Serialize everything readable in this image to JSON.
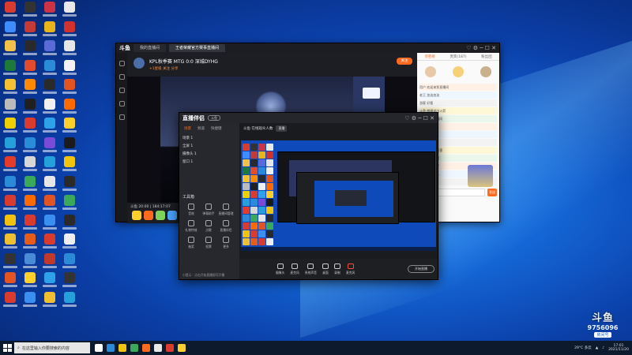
{
  "desktop": {
    "icon_colors": [
      "#d93b2f",
      "#333",
      "#cc3344",
      "#e8e8e8",
      "#3f8cff",
      "#c43a36",
      "#e9b31a",
      "#d2322d",
      "#f5c04a",
      "#2a2a2a",
      "#5a6bd8",
      "#e6e6e6",
      "#1d7a3a",
      "#e14c2c",
      "#2b8bd8",
      "#f2f2f2",
      "#f2c232",
      "#ff8a00",
      "#2a2a2a",
      "#e25522",
      "#bbbbbb",
      "#202020",
      "#f0f0f0",
      "#ff6a00",
      "#f0d000",
      "#d93b2f",
      "#2fa1e8",
      "#ffcf2e",
      "#26a0da",
      "#2a8bd8",
      "#7a4ad8",
      "#1b1b1b",
      "#e53c2a",
      "#d7d7d7",
      "#26a0da",
      "#f1c40f",
      "#2b8bd8",
      "#3aaa5a",
      "#e6e6e6",
      "#2a2a2a",
      "#d93b2f",
      "#ff6a00",
      "#e25522",
      "#3aaa5a",
      "#f4c20d",
      "#d93b2f",
      "#3a8ff0",
      "#2a2a2a",
      "#f0c030",
      "#e85c1a",
      "#d93b2f",
      "#eeeeee",
      "#333333",
      "#4a8bd8",
      "#c0392b",
      "#2b8bd8",
      "#e25522",
      "#ffcf2e",
      "#2fa1e8",
      "#333",
      "#d93b2f",
      "#3a8ff0",
      "#f0c030",
      "#26a0da"
    ]
  },
  "big_window": {
    "logo": "斗鱼",
    "tabs": [
      "我的直播间",
      "王者荣耀官方赛事直播间"
    ],
    "room_title": "KPL秋季赛 MTG 0:0 深城DYHG",
    "subtitle": "+1星级 关注 分享",
    "follow": "关注",
    "controls": "♡ ⚙ ─ ☐ ✕",
    "stream_info": "斗鱼 20:00 | 184:17:07",
    "chat_tabs": [
      "亲密榜",
      "贵宾(187)",
      "粉丝团"
    ],
    "chat_lines": [
      "用户 欢迎来到直播间",
      "老王 加油加油",
      "游客 好看",
      "斗鱼 感谢送出火箭",
      "某人 进入直播间",
      "弹幕 哈哈哈",
      "粉丝 打卡",
      "小鱼 666",
      "路人 主播真厉害",
      "观众 进来看看",
      "用户 来了来了",
      "游客 欢迎新人",
      "粉丝 冲冲冲"
    ],
    "chat_send": "发送",
    "gift_colors": [
      "#ffcf2e",
      "#ff6a1f",
      "#7fd35b",
      "#4aa3ff",
      "#c06cf0"
    ]
  },
  "mid_window": {
    "logo": "直播伴侣",
    "badge": "斗鱼",
    "controls": "♡ ⚙ ─ ☐ ✕",
    "side_tabs": [
      "场景",
      "频道",
      "快捷键"
    ],
    "scenes": [
      "场景 1",
      "全屏 1",
      "摄像头 1",
      "窗口 1"
    ],
    "tools_title": "工具箱",
    "tools": [
      "音效",
      "弹幕助手",
      "直播间管理",
      "礼物特效",
      "点歌",
      "直播伴侣",
      "抽奖",
      "投票",
      "更多"
    ],
    "main_head": "斗鱼 在线观众人数",
    "main_tag": "直播",
    "bottom_note": "小提示：点击开始直播即可开播",
    "bar_buttons": [
      "摄像头",
      "麦克风",
      "系统声音",
      "桌面",
      "录制",
      "麦克风"
    ],
    "start_label": "开始直播"
  },
  "taskbar": {
    "search_placeholder": "在这里输入你要搜索的内容",
    "app_colors": [
      "#ffffff",
      "#2b8bd8",
      "#f1c40f",
      "#3aaa5a",
      "#ff6a1f",
      "#e8e8e8",
      "#d93b2f",
      "#ffcf2e"
    ],
    "weather": "29°C 多云",
    "time": "17:01",
    "date": "2021/11/20"
  },
  "watermark": {
    "logo": "斗鱼",
    "room": "9756096",
    "label": "房间号"
  }
}
